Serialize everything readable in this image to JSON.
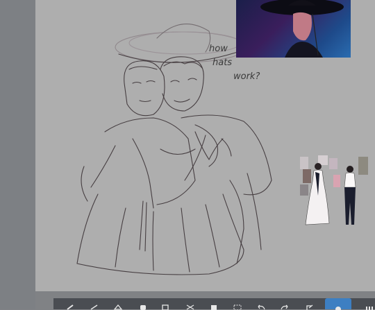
{
  "canvas": {
    "sketch_notes": [
      "how",
      "hats",
      "work?"
    ]
  },
  "toolbar": {
    "tools": [
      {
        "icon": "brush-icon",
        "active": false
      },
      {
        "icon": "pencil-icon",
        "active": false
      },
      {
        "icon": "eraser-icon",
        "active": false
      },
      {
        "icon": "hand-icon",
        "active": false
      },
      {
        "icon": "layers-icon",
        "active": false
      },
      {
        "icon": "scissors-icon",
        "active": false
      },
      {
        "icon": "clipboard-icon",
        "active": false
      },
      {
        "icon": "selection-icon",
        "active": false
      },
      {
        "icon": "undo-icon",
        "active": false
      },
      {
        "icon": "redo-icon",
        "active": false
      },
      {
        "icon": "fullscreen-icon",
        "active": false
      },
      {
        "icon": "reference-icon",
        "active": true
      },
      {
        "icon": "grid-menu-icon",
        "active": false
      }
    ],
    "active_color": "#3d7fc2"
  }
}
